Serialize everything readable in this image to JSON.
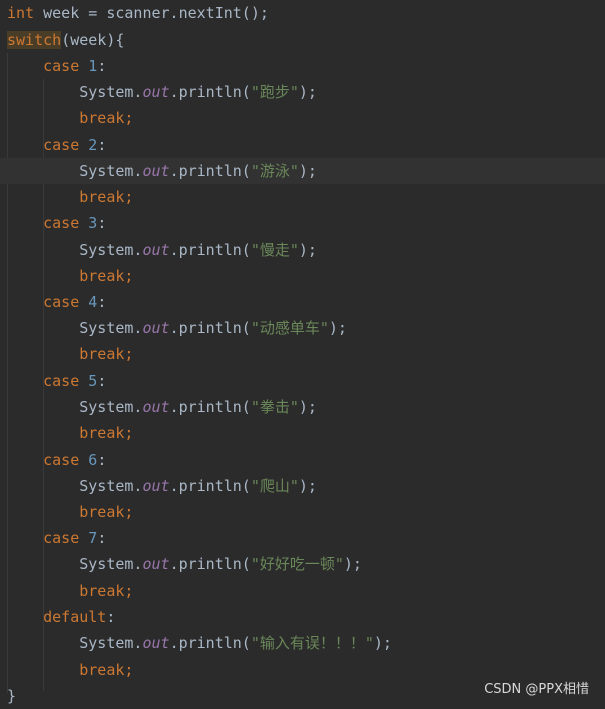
{
  "editor": {
    "line1": {
      "kw": "int",
      "rest": " week = scanner.nextInt();"
    },
    "line2": {
      "kw": "switch",
      "rest": "(week){"
    },
    "case_kw": "case",
    "break_kw": "break",
    "colon": ":",
    "semicolon": ";",
    "sys_prefix": "System.",
    "out_field": "out",
    "println_open": ".println(",
    "println_close": ");",
    "cases": [
      {
        "num": "1",
        "text": "\"跑步\""
      },
      {
        "num": "2",
        "text": "\"游泳\""
      },
      {
        "num": "3",
        "text": "\"慢走\""
      },
      {
        "num": "4",
        "text": "\"动感单车\""
      },
      {
        "num": "5",
        "text": "\"拳击\""
      },
      {
        "num": "6",
        "text": "\"爬山\""
      },
      {
        "num": "7",
        "text": "\"好好吃一顿\""
      }
    ],
    "default_kw": "default",
    "default_text": "\"输入有误！！！\"",
    "closing_brace": "}"
  },
  "watermark": "CSDN @PPX相惜",
  "colors": {
    "background": "#2b2b2b",
    "current_line": "#323232",
    "keyword": "#cc7832",
    "number": "#6897bb",
    "string": "#6a8759",
    "field": "#9876aa",
    "default_text": "#a9b7c6"
  }
}
